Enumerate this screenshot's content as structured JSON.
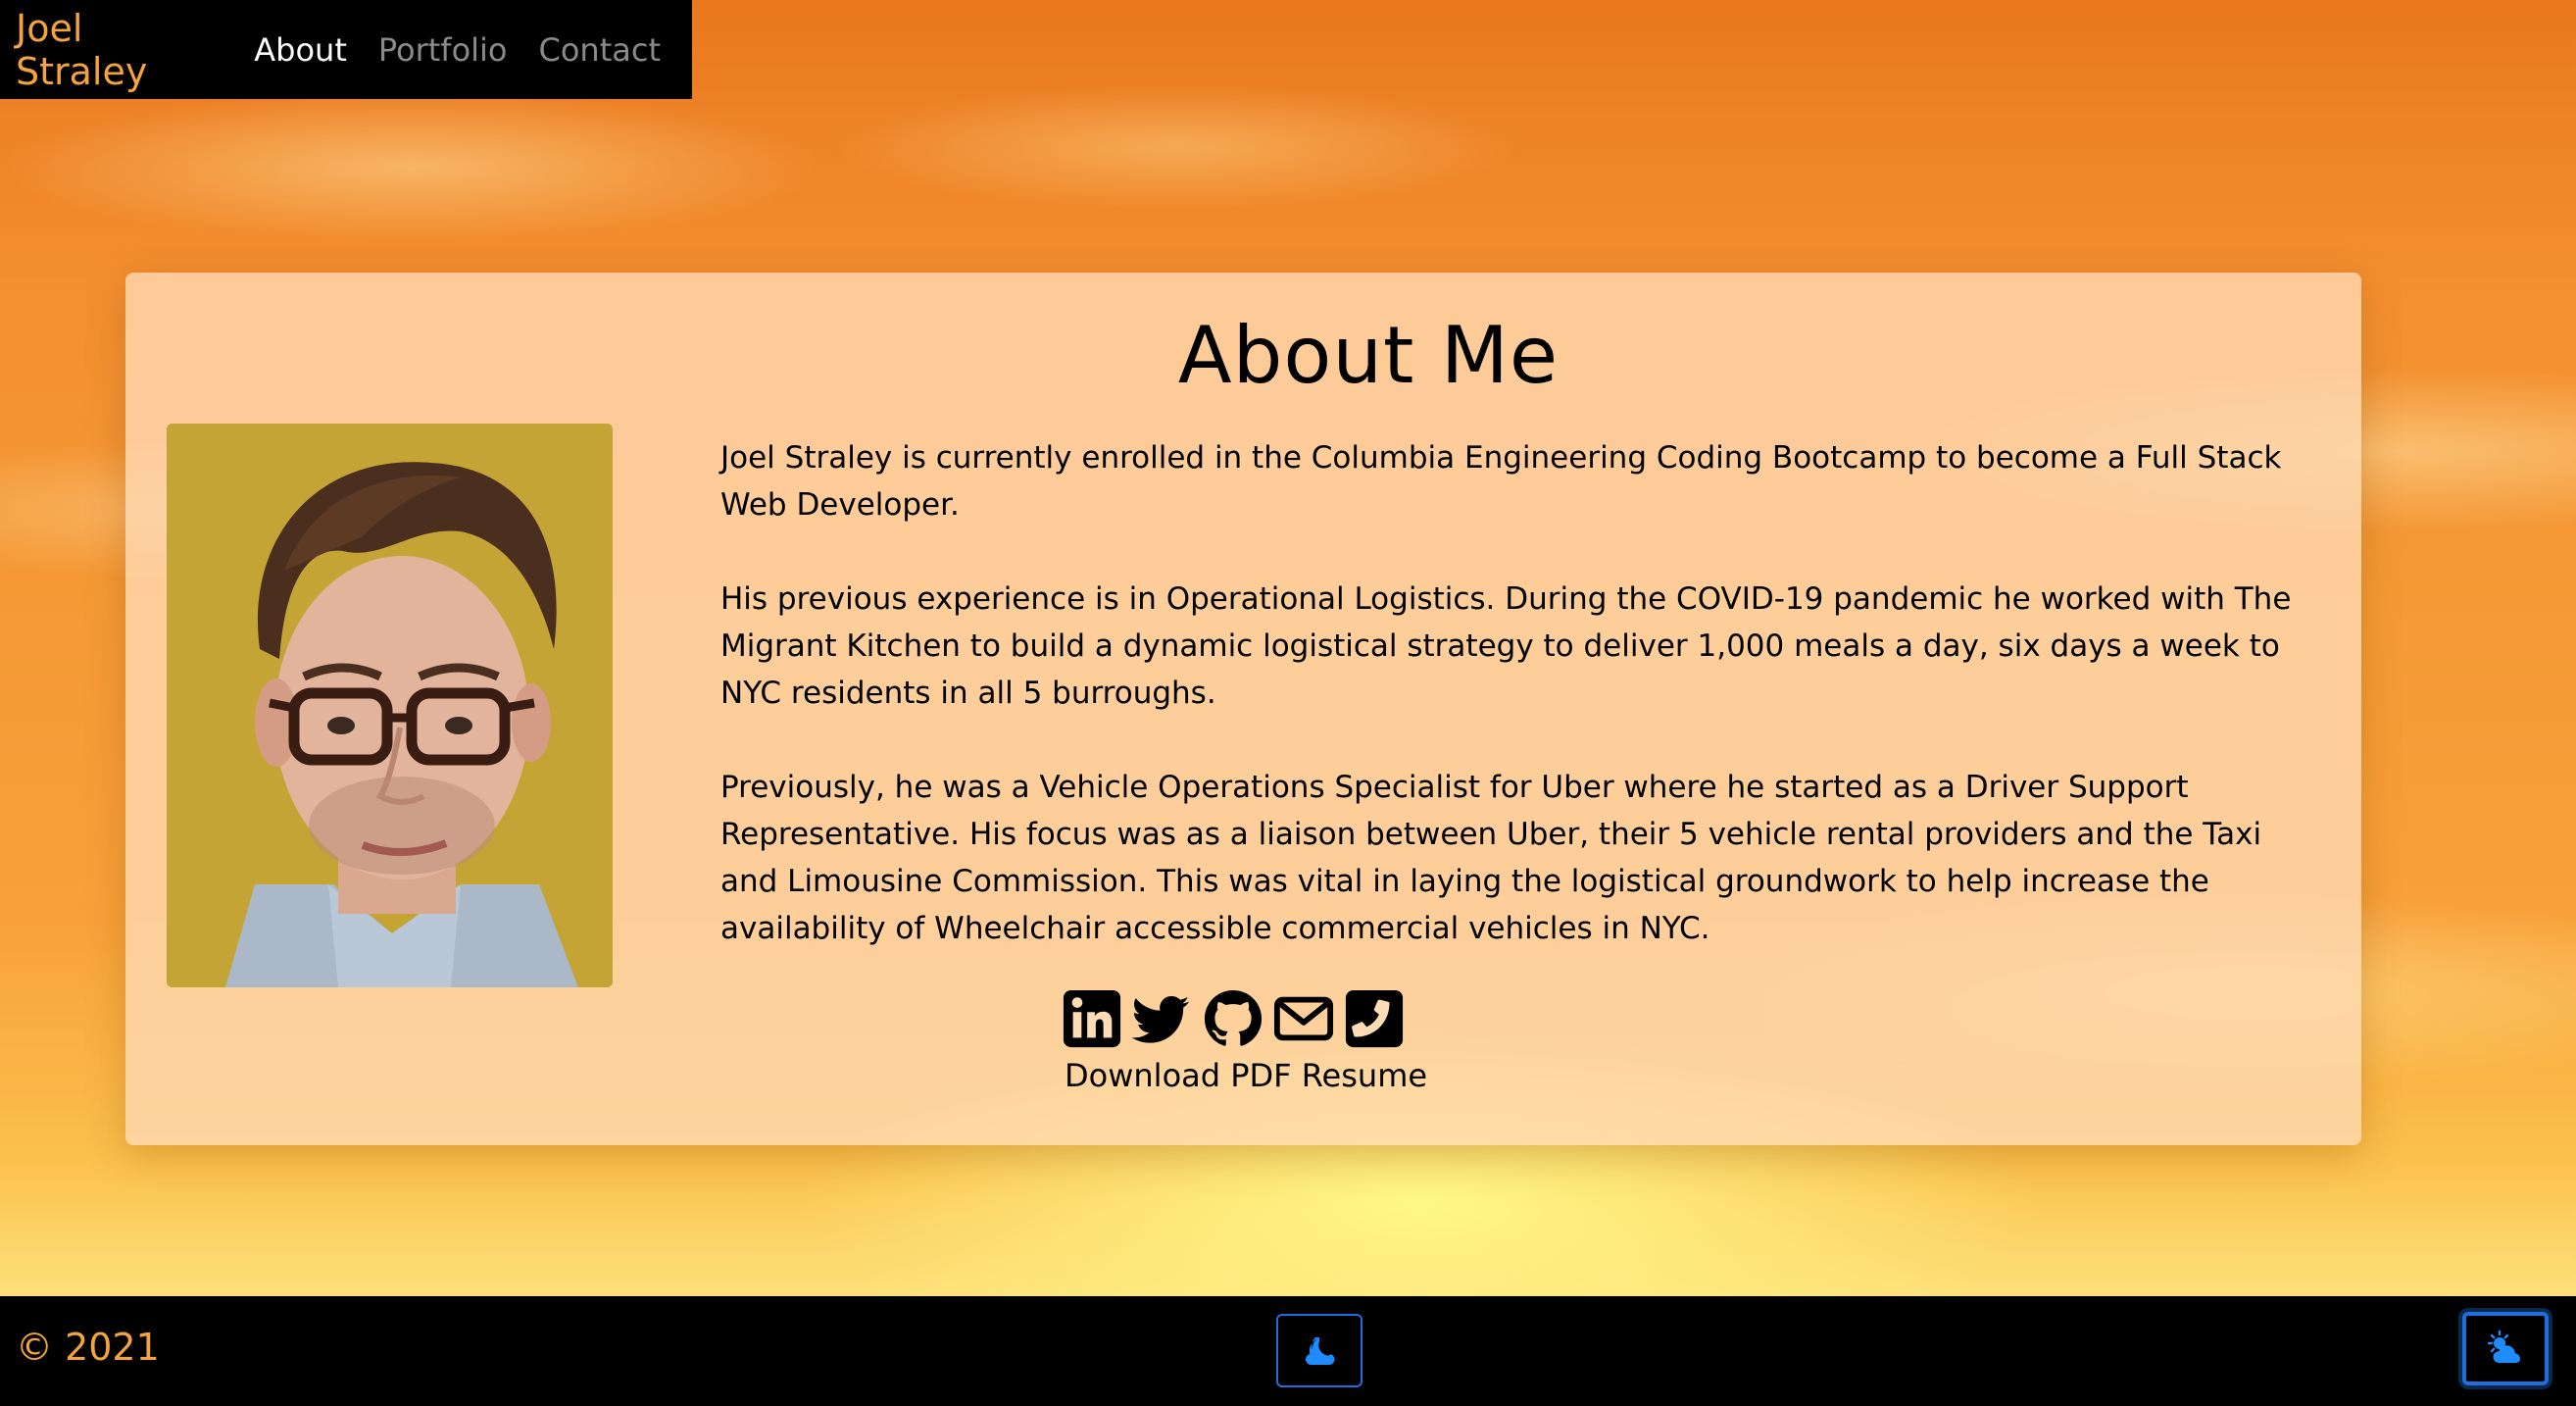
{
  "navbar": {
    "brand": "Joel Straley",
    "links": [
      {
        "label": "About",
        "active": true
      },
      {
        "label": "Portfolio",
        "active": false
      },
      {
        "label": "Contact",
        "active": false
      }
    ]
  },
  "about": {
    "title": "About Me",
    "photo_alt": "Portrait photo of Joel Straley",
    "paragraphs": [
      "Joel Straley is currently enrolled in the Columbia Engineering Coding Bootcamp to become a Full Stack Web Developer.",
      "His previous experience is in Operational Logistics. During the COVID-19 pandemic he worked with The Migrant Kitchen to build a dynamic logistical strategy to deliver 1,000 meals a day, six days a week to NYC residents in all 5 burroughs.",
      "Previously, he was a Vehicle Operations Specialist for Uber where he started as a Driver Support Representative. His focus was as a liaison between Uber, their 5 vehicle rental providers and the Taxi and Limousine Commission. This was vital in laying the logistical groundwork to help increase the availability of Wheelchair accessible commercial vehicles in NYC."
    ],
    "social_icons": [
      "linkedin-icon",
      "twitter-icon",
      "github-icon",
      "envelope-icon",
      "phone-icon"
    ],
    "resume_link": "Download PDF Resume"
  },
  "footer": {
    "copyright": "© 2021",
    "buttons": [
      "moon-icon",
      "cloud-sun-icon"
    ]
  },
  "colors": {
    "brand": "#f3a43c",
    "nav_bg": "#000000",
    "button_border": "#1e6fdb",
    "icon_blue": "#1e8bff"
  }
}
